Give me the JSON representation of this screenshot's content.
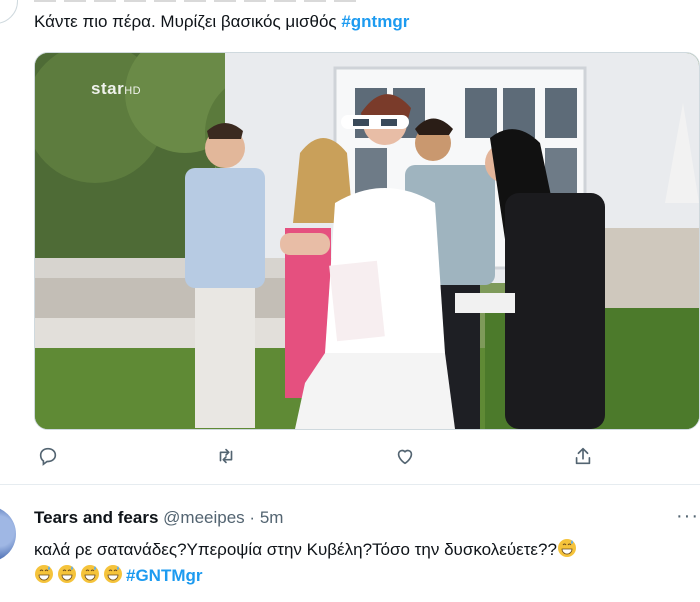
{
  "top_tweet": {
    "text": "Κάντε πιο πέρα. Μυρίζει βασικός μισθός ",
    "hashtag": "#gntmgr"
  },
  "media": {
    "channel_logo": "star",
    "channel_logo_suffix": "HD"
  },
  "actions": {
    "reply_icon": "reply-icon",
    "retweet_icon": "retweet-icon",
    "like_icon": "heart-icon",
    "share_icon": "share-icon"
  },
  "second_tweet": {
    "name": "Tears and fears",
    "handle": "@meeipes",
    "dot": "·",
    "time": "5m",
    "more": "···",
    "text": "καλά ρε σατανάδες?Υπεροψία στην Κυβέλη?Τόσο την δυσκολεύετε??",
    "emoji": "grinning-sweat-emoji",
    "hashtag": "#GNTMgr"
  },
  "colors": {
    "hashtag": "#1d9bf0",
    "secondary_text": "#536471",
    "primary_text": "#0f1419"
  }
}
